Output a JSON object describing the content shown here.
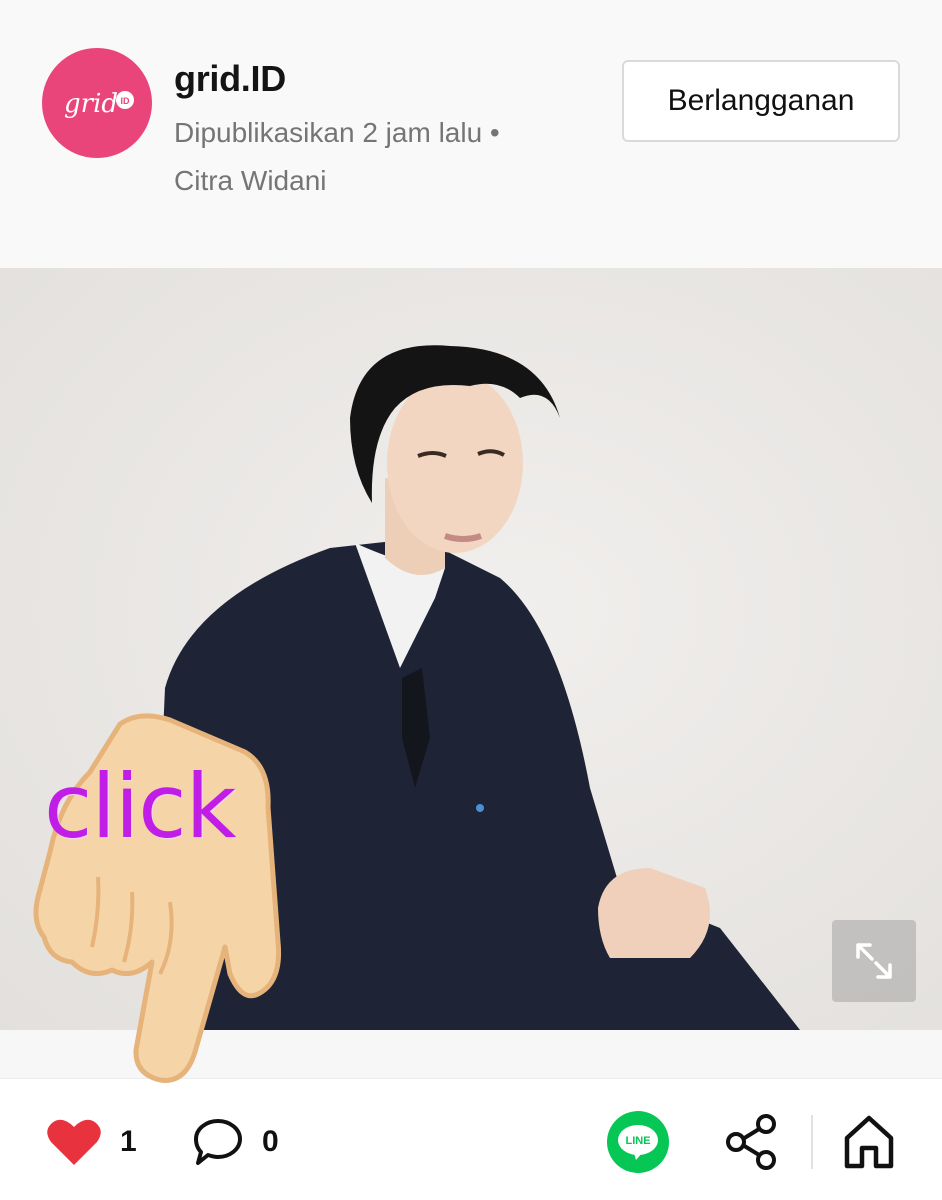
{
  "header": {
    "channel_name": "grid.ID",
    "avatar_logo_text": "grid",
    "avatar_logo_badge": "ID",
    "published": "Dipublikasikan 2 jam lalu •",
    "author": "Citra Widani",
    "subscribe_label": "Berlangganan"
  },
  "photo": {
    "expand_icon": "expand-arrows-icon"
  },
  "overlay": {
    "click_text": "click",
    "hand_icon": "pointing-hand-icon"
  },
  "actions": {
    "like_count": "1",
    "comment_count": "0",
    "line_label": "LINE",
    "colors": {
      "like": "#e8333f",
      "line": "#06c755",
      "avatar": "#e9457a"
    }
  }
}
